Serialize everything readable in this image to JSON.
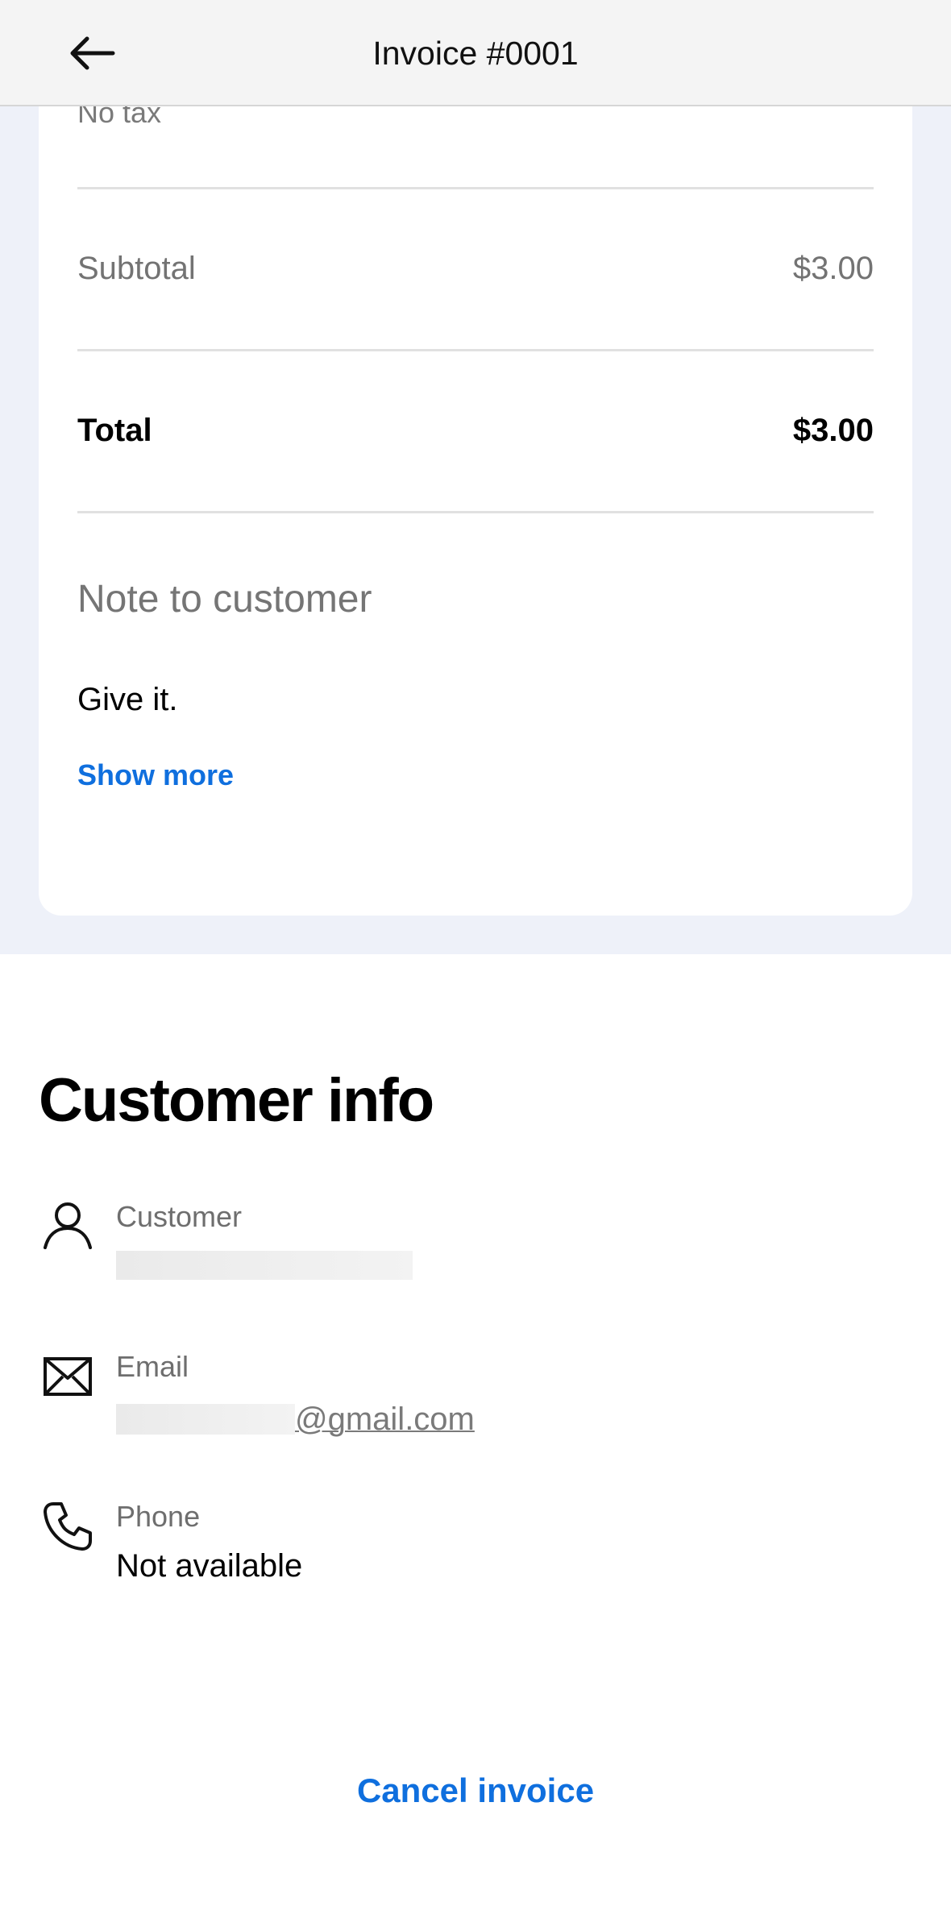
{
  "header": {
    "title": "Invoice #0001",
    "back_icon": "arrow-left-icon"
  },
  "summary": {
    "tax_label": "No tax",
    "subtotal_label": "Subtotal",
    "subtotal_value": "$3.00",
    "total_label": "Total",
    "total_value": "$3.00"
  },
  "note": {
    "heading": "Note to customer",
    "body": "Give it.",
    "show_more_label": "Show more"
  },
  "customer_info": {
    "title": "Customer info",
    "customer": {
      "icon": "person-icon",
      "label": "Customer"
    },
    "email": {
      "icon": "envelope-icon",
      "label": "Email",
      "visible_value": "@gmail.com"
    },
    "phone": {
      "icon": "phone-icon",
      "label": "Phone",
      "value": "Not available"
    }
  },
  "actions": {
    "cancel_label": "Cancel invoice"
  },
  "colors": {
    "accent": "#0f6fde",
    "page_background": "#eef1f9",
    "muted_text": "#737373"
  }
}
